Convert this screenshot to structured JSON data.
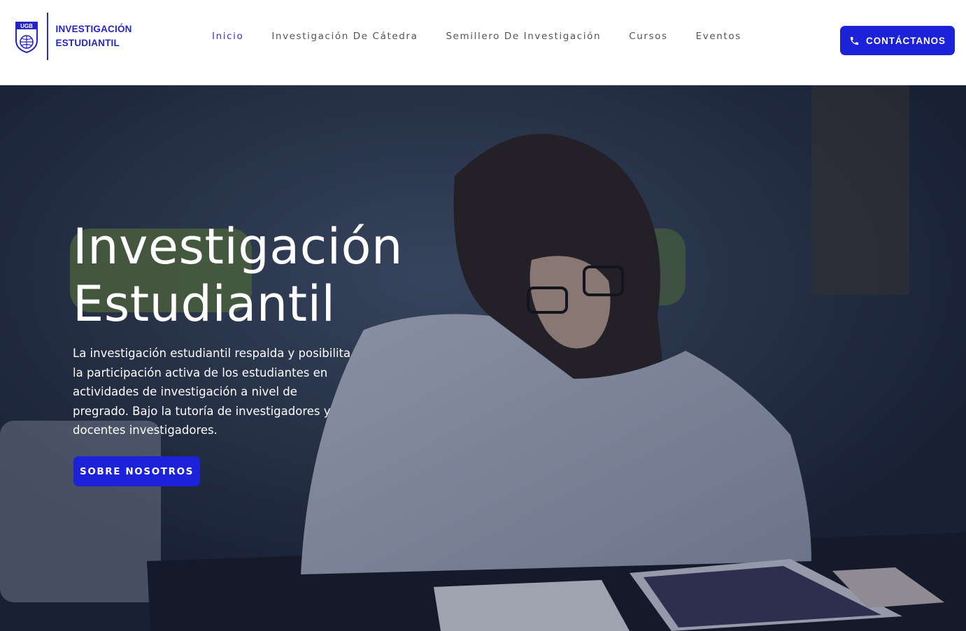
{
  "header": {
    "logo": {
      "badge_text": "UGB",
      "line1": "INVESTIGACIÓN",
      "line2": "ESTUDIANTIL"
    },
    "nav": [
      {
        "label": "Inicio",
        "active": true
      },
      {
        "label": "Investigación De Cátedra",
        "active": false
      },
      {
        "label": "Semillero De Investigación",
        "active": false
      },
      {
        "label": "Cursos",
        "active": false
      },
      {
        "label": "Eventos",
        "active": false
      }
    ],
    "cta_label": "CONTÁCTANOS",
    "cta_icon": "phone-icon"
  },
  "hero": {
    "title_line1": "Investigación",
    "title_line2": "Estudiantil",
    "description": "La investigación estudiantil respalda y posibilita la participación activa de los estudiantes en actividades de investigación a nivel de pregrado. Bajo la tutoría de investigadores y docentes investigadores.",
    "button_label": "SOBRE NOSOTROS",
    "image_subject": "student-studying-photo"
  },
  "colors": {
    "brand": "#1c22d8",
    "nav_active": "#3a37b5",
    "nav_text": "#555555"
  }
}
